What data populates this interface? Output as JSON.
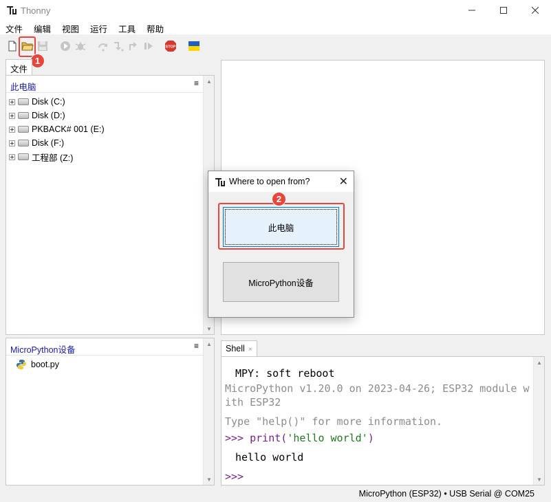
{
  "app": {
    "title": "Thonny",
    "window_controls": {
      "minimize": "—",
      "maximize": "☐",
      "close": "✕"
    }
  },
  "menu": [
    "文件",
    "编辑",
    "视图",
    "运行",
    "工具",
    "帮助"
  ],
  "toolbar": {
    "icons": [
      "new-file-icon",
      "open-file-icon",
      "save-icon",
      "run-icon",
      "debug-icon",
      "step-over-icon",
      "step-into-icon",
      "step-out-icon",
      "resume-icon",
      "stop-icon",
      "ukraine-flag-icon"
    ],
    "stop_label": "STOP",
    "colors": {
      "stop": "#d6362b",
      "run": "#37a84b",
      "flag_blue": "#1f5fbf",
      "flag_yellow": "#ffd500"
    }
  },
  "annotations": {
    "badge1": "1",
    "badge2": "2",
    "color": "#e8453c"
  },
  "files_pane": {
    "tab_label": "文件",
    "computer_header": "此电脑",
    "menu_glyph": "≡",
    "drives": [
      "Disk (C:)",
      "Disk (D:)",
      "PKBACK# 001 (E:)",
      "Disk (F:)",
      "工程部 (Z:)"
    ],
    "device_header": "MicroPython设备",
    "device_files": [
      "boot.py"
    ]
  },
  "shell": {
    "tab_label": "Shell",
    "tab_close": "×",
    "lines": {
      "soft_reboot": "MPY: soft reboot",
      "version_1": "MicroPython v1.20.0 on 2023-04-26; ESP32 module w",
      "version_2": "ith ESP32",
      "help_hint": "Type \"help()\" for more information.",
      "prompt": ">>> ",
      "cmd_fn": "print(",
      "cmd_str": "'hello world'",
      "cmd_end": ")",
      "output": "hello world",
      "prompt2": ">>>"
    }
  },
  "status": {
    "text": "MicroPython (ESP32)  •  USB Serial @ COM25"
  },
  "dialog": {
    "title": "Where to open from?",
    "close": "✕",
    "option_computer": "此电脑",
    "option_device": "MicroPython设备"
  }
}
